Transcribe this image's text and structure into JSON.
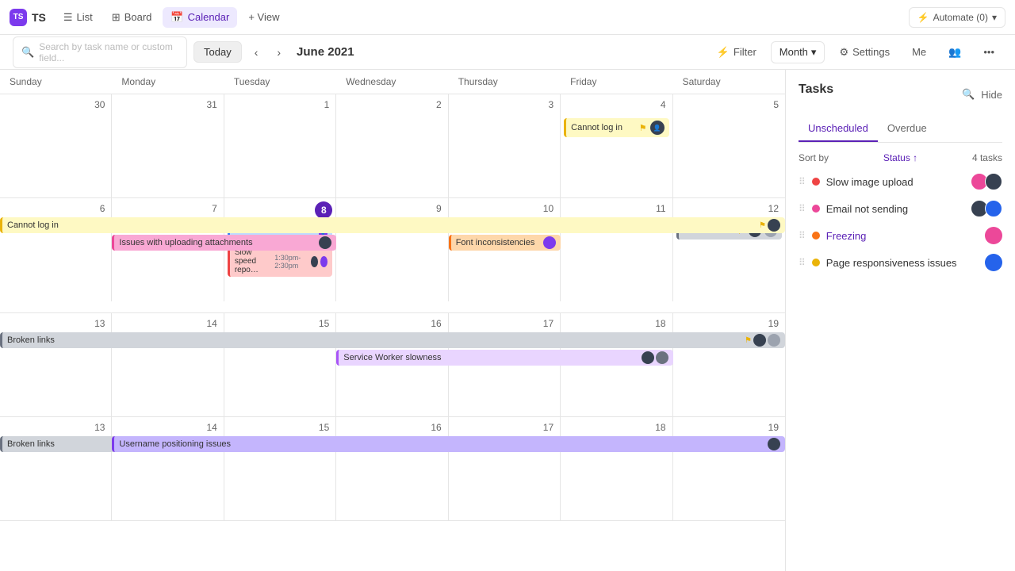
{
  "app": {
    "logo_text": "TS",
    "nav_items": [
      {
        "id": "list",
        "label": "List",
        "icon": "☰",
        "active": false
      },
      {
        "id": "board",
        "label": "Board",
        "icon": "⊞",
        "active": false
      },
      {
        "id": "calendar",
        "label": "Calendar",
        "icon": "📅",
        "active": true
      },
      {
        "id": "view",
        "label": "+ View",
        "icon": "",
        "active": false
      }
    ],
    "automate_label": "Automate (0)"
  },
  "toolbar": {
    "search_placeholder": "Search by task name or custom field...",
    "today_label": "Today",
    "current_month": "June 2021",
    "filter_label": "Filter",
    "month_label": "Month",
    "settings_label": "Settings",
    "me_label": "Me"
  },
  "calendar": {
    "day_names": [
      "Sunday",
      "Monday",
      "Tuesday",
      "Wednesday",
      "Thursday",
      "Friday",
      "Saturday"
    ],
    "weeks": [
      {
        "dates": [
          "",
          "",
          "",
          "",
          "",
          "",
          ""
        ],
        "date_nums": [
          "",
          "",
          "",
          "",
          "",
          "",
          ""
        ],
        "events_in_cells": [
          {
            "col": 5,
            "label": "Cannot log in",
            "color": "yellow",
            "flag": true,
            "avatar": "dark"
          }
        ]
      }
    ]
  },
  "tasks_panel": {
    "title": "Tasks",
    "tabs": [
      {
        "id": "unscheduled",
        "label": "Unscheduled",
        "active": true
      },
      {
        "id": "overdue",
        "label": "Overdue",
        "active": false
      }
    ],
    "sort_label": "Sort by",
    "sort_field": "Status",
    "task_count": "4 tasks",
    "tasks": [
      {
        "id": 1,
        "name": "Slow image upload",
        "dot_color": "red",
        "avatar_color": "pink",
        "is_link": false
      },
      {
        "id": 2,
        "name": "Email not sending",
        "dot_color": "pink",
        "avatar_color": "dark",
        "is_link": false
      },
      {
        "id": 3,
        "name": "Freezing",
        "dot_color": "orange",
        "avatar_color": "pink",
        "is_link": true
      },
      {
        "id": 4,
        "name": "Page responsiveness issues",
        "dot_color": "yellow",
        "avatar_color": "blue",
        "is_link": false
      }
    ]
  }
}
